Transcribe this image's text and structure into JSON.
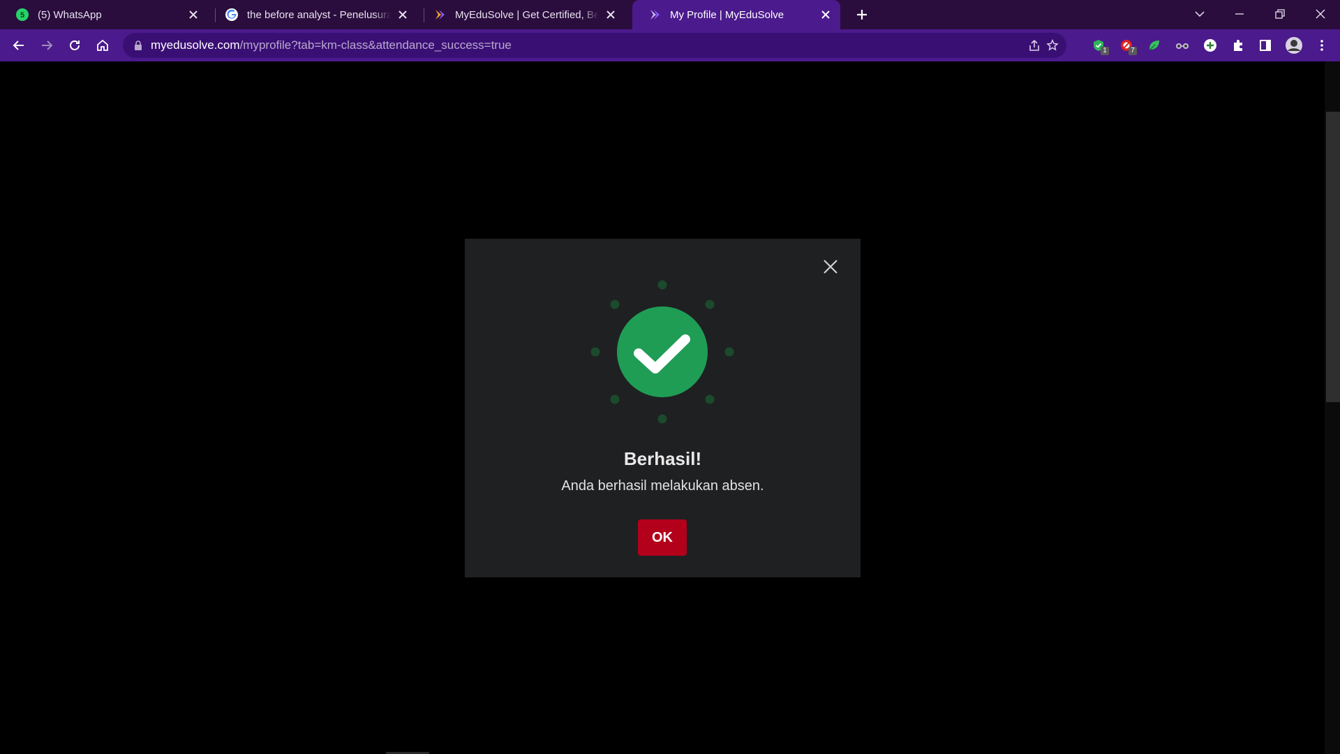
{
  "browser": {
    "tabs": [
      {
        "title": "(5) WhatsApp",
        "favicon": "whatsapp-icon",
        "badge": "5",
        "active": false
      },
      {
        "title": "the before analyst - Penelusuran Google",
        "favicon": "google-icon",
        "active": false
      },
      {
        "title": "MyEduSolve | Get Certified, Be Qualified",
        "favicon": "myedusolve-icon",
        "active": false
      },
      {
        "title": "My Profile | MyEduSolve",
        "favicon": "myedusolve-icon",
        "active": true
      }
    ],
    "url_host": "myedusolve.com",
    "url_path": "/myprofile?tab=km-class&attendance_success=true",
    "extensions": [
      {
        "name": "shield-extension-icon",
        "badge": "1"
      },
      {
        "name": "adblock-extension-icon",
        "badge": "7"
      },
      {
        "name": "leaf-extension-icon"
      },
      {
        "name": "glasses-extension-icon"
      },
      {
        "name": "plus-extension-icon"
      }
    ],
    "colors": {
      "tabstrip": "#2a0d3d",
      "toolbar": "#4b1a8c",
      "omnibox": "#3a0f74"
    }
  },
  "modal": {
    "title": "Berhasil!",
    "message": "Anda berhasil melakukan absen.",
    "ok_label": "OK",
    "icon": "success-check-icon",
    "colors": {
      "background": "#1f2022",
      "success": "#1f9d55",
      "ok_button": "#b3001b"
    }
  }
}
